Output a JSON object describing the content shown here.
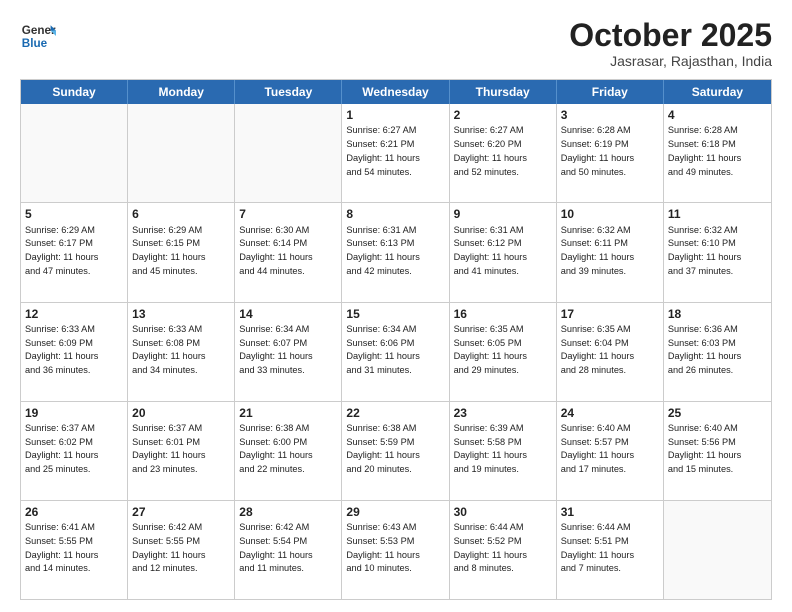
{
  "header": {
    "logo_line1": "General",
    "logo_line2": "Blue",
    "month": "October 2025",
    "location": "Jasrasar, Rajasthan, India"
  },
  "weekdays": [
    "Sunday",
    "Monday",
    "Tuesday",
    "Wednesday",
    "Thursday",
    "Friday",
    "Saturday"
  ],
  "rows": [
    [
      {
        "day": "",
        "text": ""
      },
      {
        "day": "",
        "text": ""
      },
      {
        "day": "",
        "text": ""
      },
      {
        "day": "1",
        "text": "Sunrise: 6:27 AM\nSunset: 6:21 PM\nDaylight: 11 hours\nand 54 minutes."
      },
      {
        "day": "2",
        "text": "Sunrise: 6:27 AM\nSunset: 6:20 PM\nDaylight: 11 hours\nand 52 minutes."
      },
      {
        "day": "3",
        "text": "Sunrise: 6:28 AM\nSunset: 6:19 PM\nDaylight: 11 hours\nand 50 minutes."
      },
      {
        "day": "4",
        "text": "Sunrise: 6:28 AM\nSunset: 6:18 PM\nDaylight: 11 hours\nand 49 minutes."
      }
    ],
    [
      {
        "day": "5",
        "text": "Sunrise: 6:29 AM\nSunset: 6:17 PM\nDaylight: 11 hours\nand 47 minutes."
      },
      {
        "day": "6",
        "text": "Sunrise: 6:29 AM\nSunset: 6:15 PM\nDaylight: 11 hours\nand 45 minutes."
      },
      {
        "day": "7",
        "text": "Sunrise: 6:30 AM\nSunset: 6:14 PM\nDaylight: 11 hours\nand 44 minutes."
      },
      {
        "day": "8",
        "text": "Sunrise: 6:31 AM\nSunset: 6:13 PM\nDaylight: 11 hours\nand 42 minutes."
      },
      {
        "day": "9",
        "text": "Sunrise: 6:31 AM\nSunset: 6:12 PM\nDaylight: 11 hours\nand 41 minutes."
      },
      {
        "day": "10",
        "text": "Sunrise: 6:32 AM\nSunset: 6:11 PM\nDaylight: 11 hours\nand 39 minutes."
      },
      {
        "day": "11",
        "text": "Sunrise: 6:32 AM\nSunset: 6:10 PM\nDaylight: 11 hours\nand 37 minutes."
      }
    ],
    [
      {
        "day": "12",
        "text": "Sunrise: 6:33 AM\nSunset: 6:09 PM\nDaylight: 11 hours\nand 36 minutes."
      },
      {
        "day": "13",
        "text": "Sunrise: 6:33 AM\nSunset: 6:08 PM\nDaylight: 11 hours\nand 34 minutes."
      },
      {
        "day": "14",
        "text": "Sunrise: 6:34 AM\nSunset: 6:07 PM\nDaylight: 11 hours\nand 33 minutes."
      },
      {
        "day": "15",
        "text": "Sunrise: 6:34 AM\nSunset: 6:06 PM\nDaylight: 11 hours\nand 31 minutes."
      },
      {
        "day": "16",
        "text": "Sunrise: 6:35 AM\nSunset: 6:05 PM\nDaylight: 11 hours\nand 29 minutes."
      },
      {
        "day": "17",
        "text": "Sunrise: 6:35 AM\nSunset: 6:04 PM\nDaylight: 11 hours\nand 28 minutes."
      },
      {
        "day": "18",
        "text": "Sunrise: 6:36 AM\nSunset: 6:03 PM\nDaylight: 11 hours\nand 26 minutes."
      }
    ],
    [
      {
        "day": "19",
        "text": "Sunrise: 6:37 AM\nSunset: 6:02 PM\nDaylight: 11 hours\nand 25 minutes."
      },
      {
        "day": "20",
        "text": "Sunrise: 6:37 AM\nSunset: 6:01 PM\nDaylight: 11 hours\nand 23 minutes."
      },
      {
        "day": "21",
        "text": "Sunrise: 6:38 AM\nSunset: 6:00 PM\nDaylight: 11 hours\nand 22 minutes."
      },
      {
        "day": "22",
        "text": "Sunrise: 6:38 AM\nSunset: 5:59 PM\nDaylight: 11 hours\nand 20 minutes."
      },
      {
        "day": "23",
        "text": "Sunrise: 6:39 AM\nSunset: 5:58 PM\nDaylight: 11 hours\nand 19 minutes."
      },
      {
        "day": "24",
        "text": "Sunrise: 6:40 AM\nSunset: 5:57 PM\nDaylight: 11 hours\nand 17 minutes."
      },
      {
        "day": "25",
        "text": "Sunrise: 6:40 AM\nSunset: 5:56 PM\nDaylight: 11 hours\nand 15 minutes."
      }
    ],
    [
      {
        "day": "26",
        "text": "Sunrise: 6:41 AM\nSunset: 5:55 PM\nDaylight: 11 hours\nand 14 minutes."
      },
      {
        "day": "27",
        "text": "Sunrise: 6:42 AM\nSunset: 5:55 PM\nDaylight: 11 hours\nand 12 minutes."
      },
      {
        "day": "28",
        "text": "Sunrise: 6:42 AM\nSunset: 5:54 PM\nDaylight: 11 hours\nand 11 minutes."
      },
      {
        "day": "29",
        "text": "Sunrise: 6:43 AM\nSunset: 5:53 PM\nDaylight: 11 hours\nand 10 minutes."
      },
      {
        "day": "30",
        "text": "Sunrise: 6:44 AM\nSunset: 5:52 PM\nDaylight: 11 hours\nand 8 minutes."
      },
      {
        "day": "31",
        "text": "Sunrise: 6:44 AM\nSunset: 5:51 PM\nDaylight: 11 hours\nand 7 minutes."
      },
      {
        "day": "",
        "text": ""
      }
    ]
  ]
}
